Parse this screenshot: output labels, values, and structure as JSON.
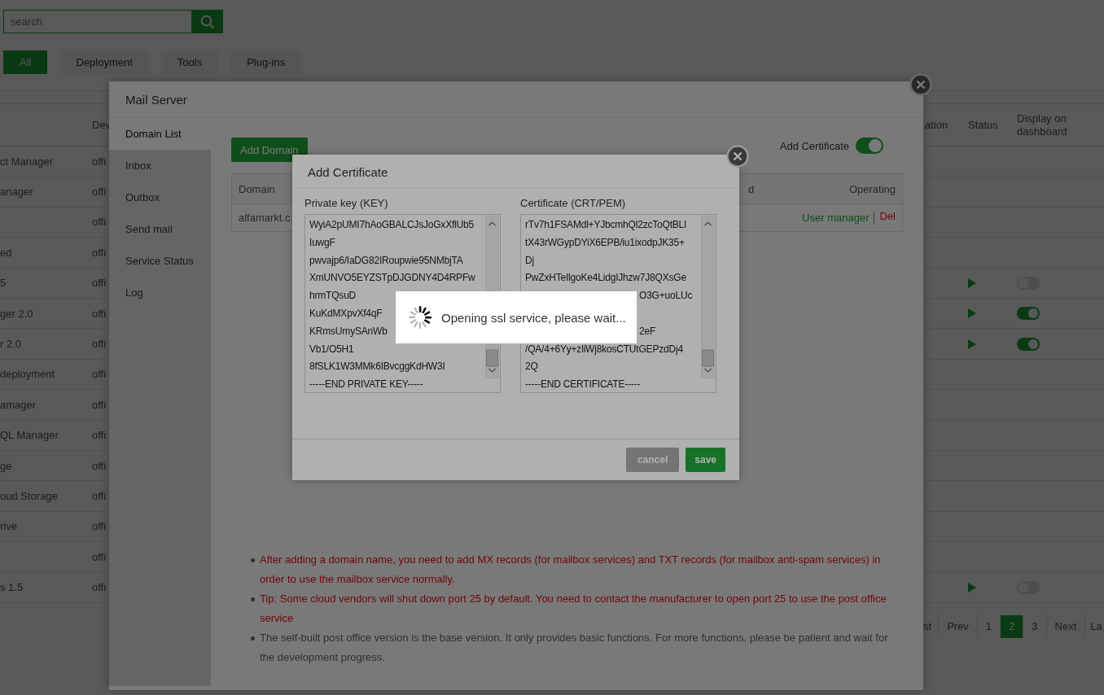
{
  "search": {
    "placeholder": "search"
  },
  "filters": [
    {
      "label": "All",
      "selected": true
    },
    {
      "label": "Deployment",
      "selected": false
    },
    {
      "label": "Tools",
      "selected": false
    },
    {
      "label": "Plug-ins",
      "selected": false
    }
  ],
  "table": {
    "columns": [
      "Dev",
      "ation",
      "Status",
      "Display on dashboard"
    ],
    "rows": [
      {
        "name": "ct Manager",
        "developer": "offi",
        "playable": false
      },
      {
        "name": "anager",
        "developer": "offi",
        "playable": false
      },
      {
        "developer": "offi",
        "playable": false
      },
      {
        "name": "ed",
        "developer": "offi",
        "playable": false
      },
      {
        "name": "5",
        "developer": "offi",
        "playable": true,
        "dashboard_on": false
      },
      {
        "name": "ger 2.0",
        "developer": "offi",
        "playable": true,
        "dashboard_on": true
      },
      {
        "name": "r 2.0",
        "developer": "offi",
        "playable": true,
        "dashboard_on": true
      },
      {
        "name": "deployment",
        "developer": "offi",
        "playable": false
      },
      {
        "name": "amager",
        "developer": "offi",
        "playable": false
      },
      {
        "name": "QL Manager",
        "developer": "offi",
        "playable": false
      },
      {
        "name": "ge",
        "developer": "offi",
        "playable": false
      },
      {
        "name": "oud Storage",
        "developer": "offi",
        "playable": false
      },
      {
        "name": "rive",
        "developer": "offi",
        "playable": false
      },
      {
        "developer": "offi",
        "playable": false
      },
      {
        "name": "s 1.5",
        "developer": "offi",
        "playable": true,
        "dashboard_on": false
      }
    ]
  },
  "pagination": [
    {
      "label": "st",
      "selected": false
    },
    {
      "label": "Prev",
      "selected": false
    },
    {
      "label": "1",
      "selected": false
    },
    {
      "label": "2",
      "selected": true
    },
    {
      "label": "3",
      "selected": false
    },
    {
      "label": "Next",
      "selected": false
    },
    {
      "label": "La",
      "selected": false
    }
  ],
  "mail_server": {
    "title": "Mail Server",
    "nav": [
      {
        "label": "Domain List",
        "selected": true
      },
      {
        "label": "Inbox",
        "selected": false
      },
      {
        "label": "Outbox",
        "selected": false
      },
      {
        "label": "Send mail",
        "selected": false
      },
      {
        "label": "Service Status",
        "selected": false
      },
      {
        "label": "Log",
        "selected": false
      }
    ],
    "add_domain_button": "Add Domain",
    "add_certificate": {
      "label": "Add Certificate",
      "on": true
    },
    "domain_table": {
      "columns": [
        "Domain",
        "d",
        "Operating"
      ],
      "rows": [
        {
          "domain": "alfamarkt.c",
          "actions": [
            {
              "label": "User manager",
              "kind": "link"
            },
            {
              "label": "Del",
              "kind": "danger"
            }
          ]
        }
      ]
    },
    "notes": [
      {
        "kind": "warning",
        "text": "After adding a domain name, you need to add MX records (for mailbox services) and TXT records (for mailbox anti-spam services) in order to use the mailbox service normally."
      },
      {
        "kind": "warning",
        "text": "Tip: Some cloud vendors will shut down port 25 by default. You need to contact the manufacturer to open port 25 to use the post office service"
      },
      {
        "kind": "info",
        "text": "The self-built post office version is the base version. It only provides basic functions. For more functions, please be patient and wait for the development progress."
      }
    ]
  },
  "cert_dialog": {
    "title": "Add Certificate",
    "fields": [
      {
        "label": "Private key (KEY)",
        "lines": [
          {
            "kind": "line",
            "text": "WyiA2pUMI7hAoGBALCJsJoGxXflUb5"
          },
          {
            "kind": "line",
            "text": "IuwgF"
          },
          {
            "kind": "line",
            "text": "pwvajp6/IaDG82IRoupwie95NMbjTA"
          },
          {
            "kind": "line",
            "text": "XmUNVO5EYZSTpDJGDNY4D4RPFw"
          },
          {
            "kind": "line",
            "text": "hrmTQsuD"
          },
          {
            "kind": "line",
            "text": "KuKdMXpvXf4qF"
          },
          {
            "kind": "line",
            "text": "KRmsUmySAnWb"
          },
          {
            "kind": "line",
            "text": "Vb1/O5H1"
          },
          {
            "kind": "line",
            "text": "8fSLK1W3MMk6IBvcggKdHW3I"
          },
          {
            "kind": "line",
            "text": "-----END PRIVATE KEY-----"
          }
        ]
      },
      {
        "label": "Certificate (CRT/PEM)",
        "lines": [
          {
            "kind": "line",
            "text": "rTv7h1FSAMdl+YJbcmhQl2zcToQtBLI"
          },
          {
            "kind": "line",
            "text": "tX43rWGypDYiX6EPB/iu1ixodpJK35+"
          },
          {
            "kind": "line",
            "text": "Dj"
          },
          {
            "kind": "line",
            "text": "PwZxHTeIlgoKe4LidgIJhzw7J8QXsGe"
          },
          {
            "kind": "tail",
            "text": "O3G+uoLUc"
          },
          {
            "kind": "tail-gap",
            "text": "2eF"
          },
          {
            "kind": "line",
            "text": "/QA/4+6Yy+zliWj8kosCTUtGEPzdDj4"
          },
          {
            "kind": "line",
            "text": "2Q"
          },
          {
            "kind": "line",
            "text": "-----END CERTIFICATE-----"
          }
        ]
      }
    ],
    "buttons": [
      {
        "label": "cancel",
        "kind": "secondary"
      },
      {
        "label": "save",
        "kind": "primary"
      }
    ]
  },
  "toast": {
    "message": "Opening ssl service, please wait..."
  }
}
